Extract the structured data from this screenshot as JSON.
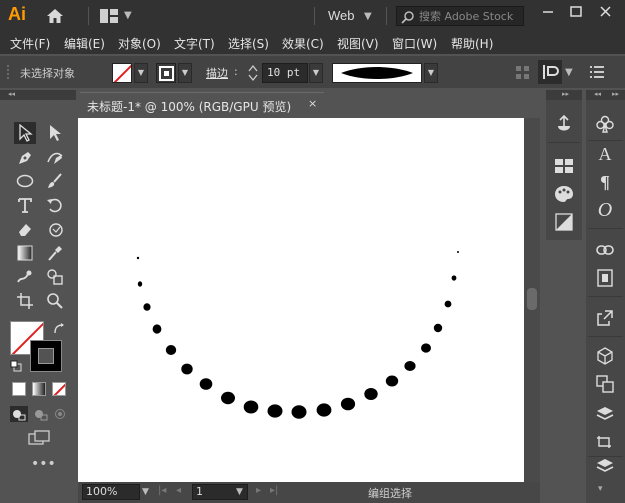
{
  "app": {
    "logo": "Ai",
    "workspace": "Web"
  },
  "search": {
    "placeholder": "搜索 Adobe Stock"
  },
  "menu": [
    "文件(F)",
    "编辑(E)",
    "对象(O)",
    "文字(T)",
    "选择(S)",
    "效果(C)",
    "视图(V)",
    "窗口(W)",
    "帮助(H)"
  ],
  "control_bar": {
    "selection_status": "未选择对象",
    "stroke_label": "描边",
    "stroke_colon": ":",
    "stroke_weight": "10 pt"
  },
  "document": {
    "tab_title": "未标题-1* @ 100% (RGB/GPU 预览)",
    "close_glyph": "×"
  },
  "status_bar": {
    "zoom": "100%",
    "page": "1",
    "status_text": "编组选择"
  },
  "colors": {
    "accent": "#ff9a00",
    "stroke_slash": "#e02020"
  },
  "icons": [
    "home-icon",
    "search-icon",
    "selection-tool-icon",
    "direct-selection-icon",
    "pen-icon",
    "curvature-icon",
    "ellipse-icon",
    "brush-icon",
    "type-icon",
    "rotate-icon",
    "eraser-icon",
    "scale-icon",
    "gradient-icon",
    "eyedropper-icon",
    "blend-icon",
    "live-paint-icon",
    "artboard-icon",
    "zoom-icon",
    "swap-icon",
    "clubs-icon",
    "character-icon",
    "paragraph-icon",
    "opentype-icon",
    "link-icon",
    "export-icon",
    "layers-icon",
    "more-icon"
  ]
}
